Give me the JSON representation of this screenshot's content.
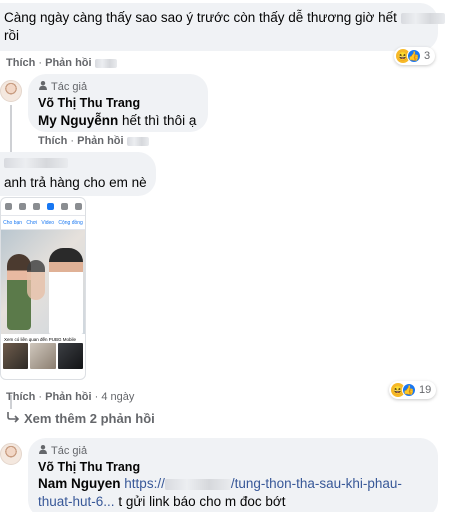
{
  "comment1": {
    "text_line1": "Càng ngày càng thấy sao sao ý trước còn thấy dễ thương giờ hết",
    "text_line2": "rồi",
    "reaction_count": "3",
    "like": "Thích",
    "reply": "Phản hồi"
  },
  "reply1": {
    "author_badge": "Tác giả",
    "author": "Võ Thị Thu Trang",
    "mention": "My Nguyễnn",
    "text": "hết thì thôi ạ",
    "like": "Thích",
    "reply": "Phản hồi"
  },
  "comment2": {
    "text": "anh trả hàng cho em nè",
    "photo_tabs": [
      "Cho bạn",
      "Chơi",
      "Video",
      "Cộng đồng"
    ],
    "photo_caption": "Xem có liên quan đến PUBG Mobile",
    "reaction_count": "19",
    "like": "Thích",
    "reply": "Phản hồi",
    "time": "· 4 ngày"
  },
  "more_replies": "Xem thêm 2 phản hồi",
  "reply2": {
    "author_badge": "Tác giả",
    "author": "Võ Thị Thu Trang",
    "mention": "Nam Nguyen",
    "link_start": "https://",
    "link_rest": "/tung-thon-tha-sau-khi-phau-",
    "link_line2": "thuat-hut-6...",
    "text_after": "t gửi link báo cho m đoc bớt"
  },
  "colors": {
    "bubble": "#f0f2f5",
    "meta_text": "#65676b",
    "link": "#385898",
    "like_blue": "#1877f2",
    "haha_yellow": "#f7b928"
  },
  "icons": [
    "haha-emoji-icon",
    "like-icon",
    "author-icon",
    "reply-arrow-icon"
  ]
}
